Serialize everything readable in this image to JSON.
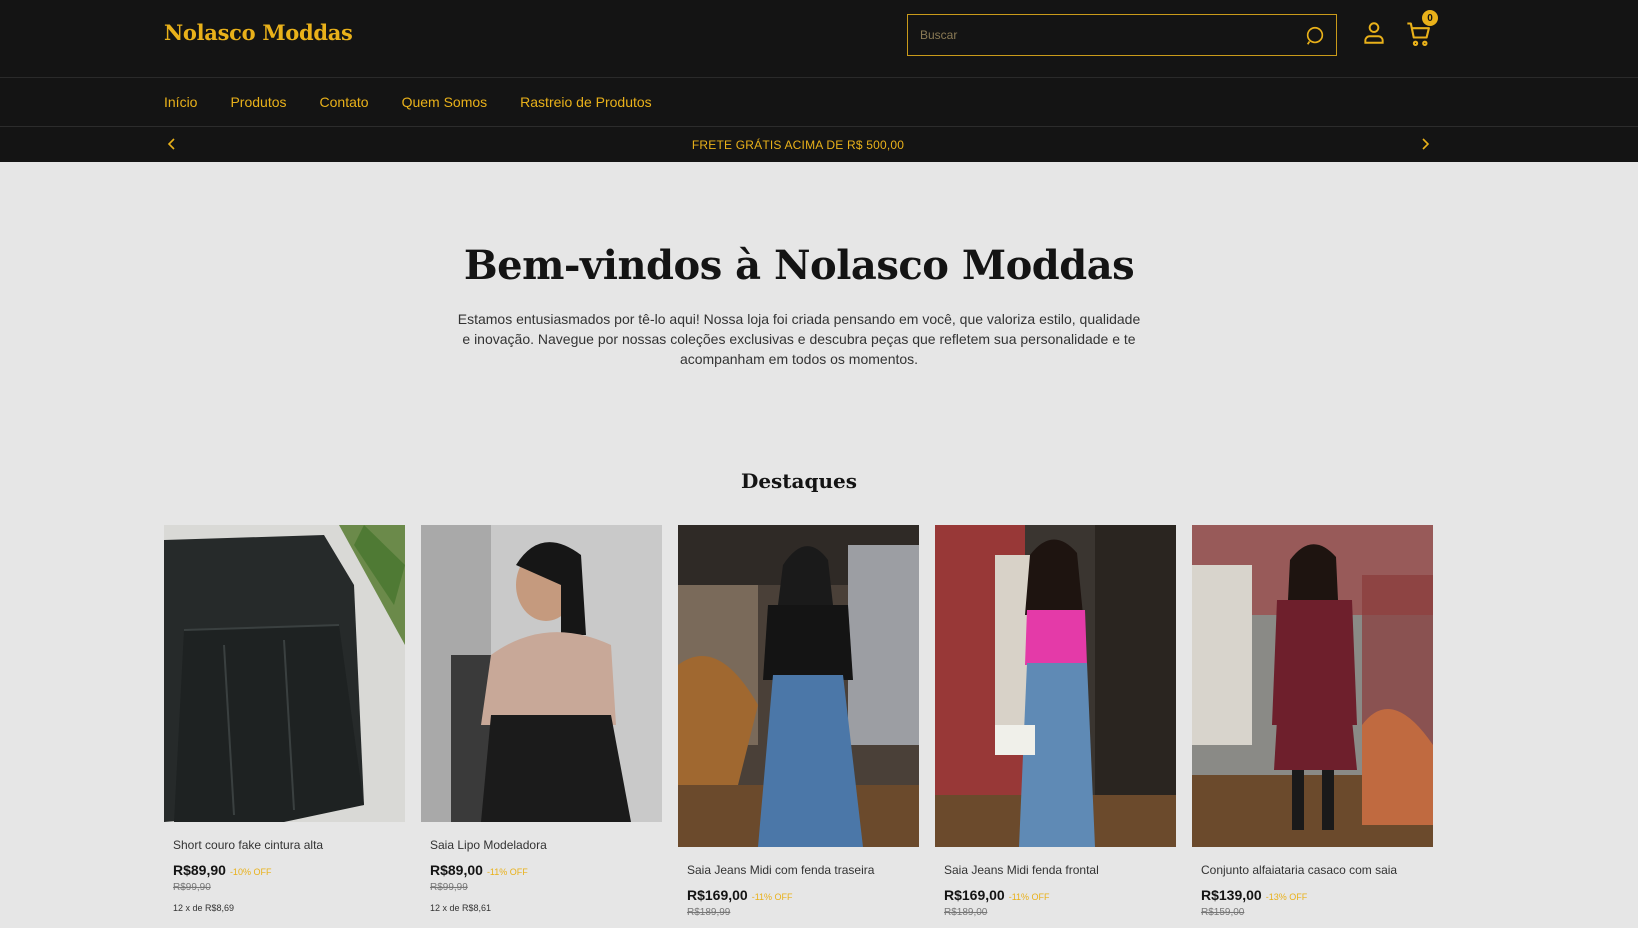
{
  "header": {
    "logo": "Nolasco Moddas",
    "search_placeholder": "Buscar",
    "cart_count": "0"
  },
  "nav": {
    "items": [
      "Início",
      "Produtos",
      "Contato",
      "Quem Somos",
      "Rastreio de Produtos"
    ]
  },
  "promo": {
    "text": "FRETE GRÁTIS ACIMA DE R$ 500,00"
  },
  "hero": {
    "title": "Bem-vindos à Nolasco Moddas",
    "description": "Estamos entusiasmados por tê-lo aqui! Nossa loja foi criada pensando em você, que valoriza estilo, qualidade e inovação. Navegue por nossas coleções exclusivas e descubra peças que refletem sua personalidade e te acompanham em todos os momentos."
  },
  "featured": {
    "title": "Destaques",
    "products": [
      {
        "name": "Short couro fake cintura alta",
        "price": "R$89,90",
        "off": "-10% OFF",
        "old_price": "R$99,90",
        "installments": "12 x de R$8,69"
      },
      {
        "name": "Saia Lipo Modeladora",
        "price": "R$89,00",
        "off": "-11% OFF",
        "old_price": "R$99,99",
        "installments": "12 x de R$8,61"
      },
      {
        "name": "Saia Jeans Midi com fenda traseira",
        "price": "R$169,00",
        "off": "-11% OFF",
        "old_price": "R$189,99",
        "installments": ""
      },
      {
        "name": "Saia Jeans Midi fenda frontal",
        "price": "R$169,00",
        "off": "-11% OFF",
        "old_price": "R$189,00",
        "installments": ""
      },
      {
        "name": "Conjunto alfaiataria casaco com saia",
        "price": "R$139,00",
        "off": "-13% OFF",
        "old_price": "R$159,00",
        "installments": ""
      }
    ]
  },
  "colors": {
    "accent": "#e9b11a",
    "header_bg": "#141414",
    "page_bg": "#e6e6e6"
  }
}
